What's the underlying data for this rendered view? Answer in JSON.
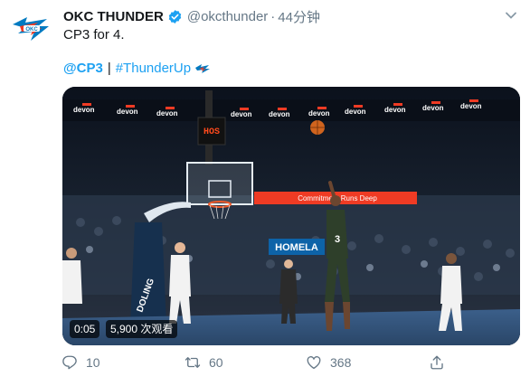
{
  "tweet": {
    "display_name": "OKC THUNDER",
    "handle": "@okcthunder",
    "separator": "·",
    "time": "44分钟",
    "text": "CP3 for 4.",
    "mention": "@CP3",
    "tag_separator": "|",
    "hashtag": "#ThunderUp"
  },
  "video": {
    "duration": "0:05",
    "views": "5,900 次观看",
    "sponsor_text": "devon",
    "shot_clock": "HOS",
    "banner_left": "HOMELA",
    "banner_right": "Commitment Runs Deep",
    "jersey_number": "3"
  },
  "actions": {
    "reply_count": "10",
    "retweet_count": "60",
    "like_count": "368"
  },
  "colors": {
    "link": "#1da1f2",
    "muted": "#657786",
    "thunder_blue": "#007ac1",
    "thunder_orange": "#ef3b24"
  },
  "icons": {
    "avatar": "okc-thunder-logo-icon",
    "verified": "verified-badge-icon",
    "caret": "chevron-down-icon",
    "reply": "reply-icon",
    "retweet": "retweet-icon",
    "like": "heart-icon",
    "share": "share-icon"
  }
}
